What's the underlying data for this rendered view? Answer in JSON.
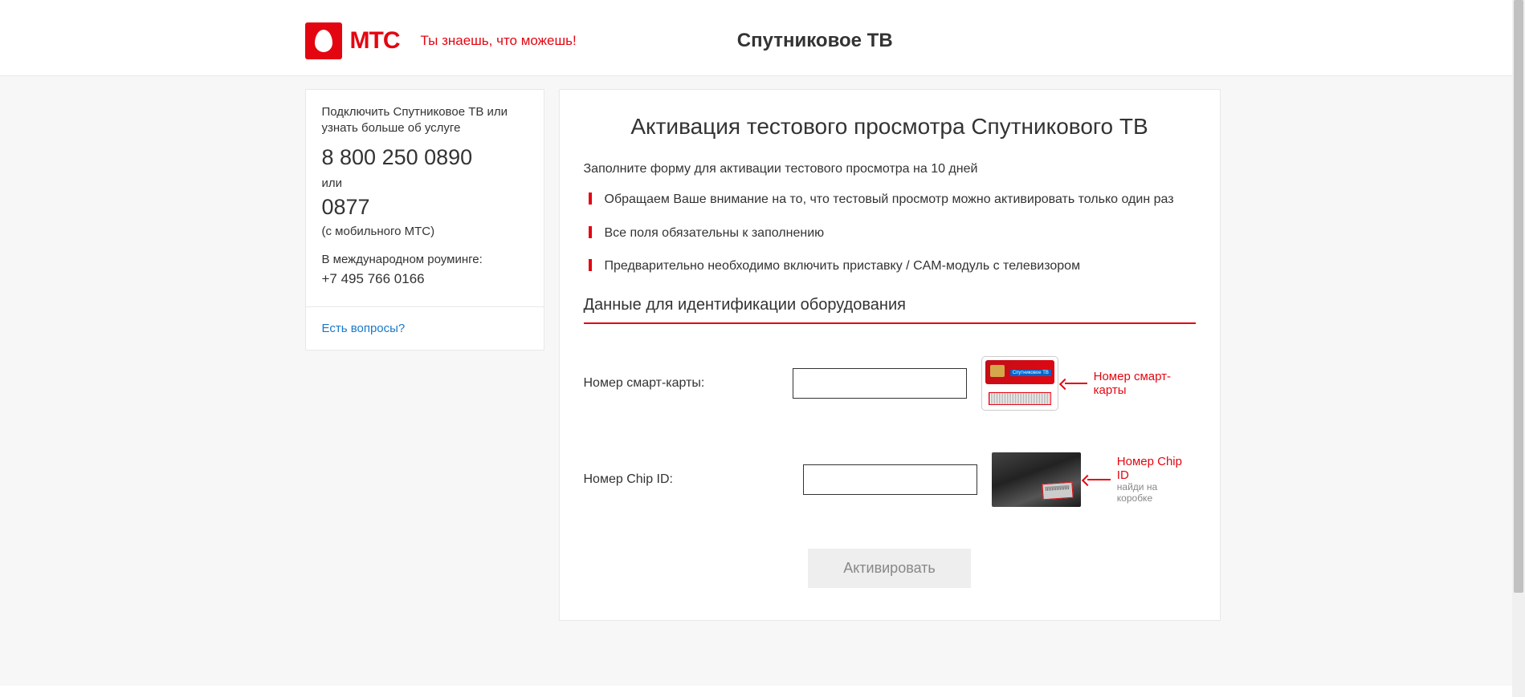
{
  "header": {
    "brand": "МТС",
    "tagline": "Ты знаешь, что можешь!",
    "service_title": "Спутниковое ТВ"
  },
  "sidebar": {
    "intro": "Подключить Спутниковое ТВ или узнать больше об услуге",
    "phone_main": "8 800 250 0890",
    "or": "или",
    "phone_short": "0877",
    "phone_note": "(с мобильного МТС)",
    "roaming_label": "В международном роуминге:",
    "roaming_phone": "+7 495 766 0166",
    "questions": "Есть вопросы?"
  },
  "main": {
    "title": "Активация тестового просмотра Спутникового ТВ",
    "intro": "Заполните форму для активации тестового просмотра на 10 дней",
    "points": [
      "Обращаем Ваше внимание на то, что тестовый просмотр можно активировать только один раз",
      "Все поля обязательны к заполнению",
      "Предварительно необходимо включить приставку / CAM-модуль с телевизором"
    ],
    "section_heading": "Данные для идентификации оборудования",
    "field_smartcard": {
      "label": "Номер смарт-карты:",
      "value": "",
      "caption": "Номер смарт-карты",
      "card_text": "Спутниковое ТВ"
    },
    "field_chipid": {
      "label": "Номер Chip ID:",
      "value": "",
      "caption": "Номер Chip ID",
      "caption_sub": "найди на коробке"
    },
    "submit": "Активировать"
  }
}
